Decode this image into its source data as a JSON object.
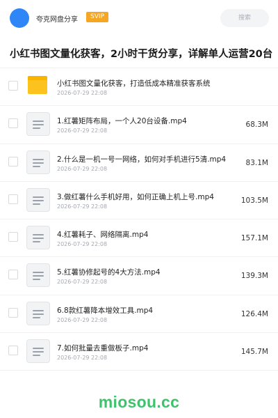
{
  "header": {
    "app_name": "夸克网盘分享",
    "badge": "SVIP",
    "search_placeholder": "搜索"
  },
  "title": "小红书图文量化获客，2小时干货分享，详解单人运营20台",
  "colors": {
    "accent": "#2f86f6",
    "svip": "#f5a623",
    "folder": "#fcc31e",
    "watermark": "#3ec26b"
  },
  "items": [
    {
      "type": "folder",
      "icon": "folder-icon",
      "name": "小红书图文量化获客，打造低成本精准获客系统",
      "date": "2026-07-29 22:08",
      "size": ""
    },
    {
      "type": "file",
      "icon": "document-icon",
      "name": "1.红薯矩阵布局，一个人20台设备.mp4",
      "date": "2026-07-29 22:08",
      "size": "68.3M"
    },
    {
      "type": "file",
      "icon": "document-icon",
      "name": "2.什么是一机一号一网络，如何对手机进行5清.mp4",
      "date": "2026-07-29 22:08",
      "size": "83.1M"
    },
    {
      "type": "file",
      "icon": "document-icon",
      "name": "3.做红薯什么手机好用，如何正确上机上号.mp4",
      "date": "2026-07-29 22:08",
      "size": "103.5M"
    },
    {
      "type": "file",
      "icon": "document-icon",
      "name": "4.红薯耗子、网络隔离.mp4",
      "date": "2026-07-29 22:08",
      "size": "157.1M"
    },
    {
      "type": "file",
      "icon": "document-icon",
      "name": "5.红薯协修起号的4大方法.mp4",
      "date": "2026-07-29 22:08",
      "size": "139.3M"
    },
    {
      "type": "file",
      "icon": "document-icon",
      "name": "6.8款红薯降本增效工具.mp4",
      "date": "2026-07-29 22:08",
      "size": "126.4M"
    },
    {
      "type": "file",
      "icon": "document-icon",
      "name": "7.如何批量去重做板子.mp4",
      "date": "2026-07-29 22:08",
      "size": "145.7M"
    }
  ],
  "footer": {
    "watermark": "miosou.cc"
  }
}
